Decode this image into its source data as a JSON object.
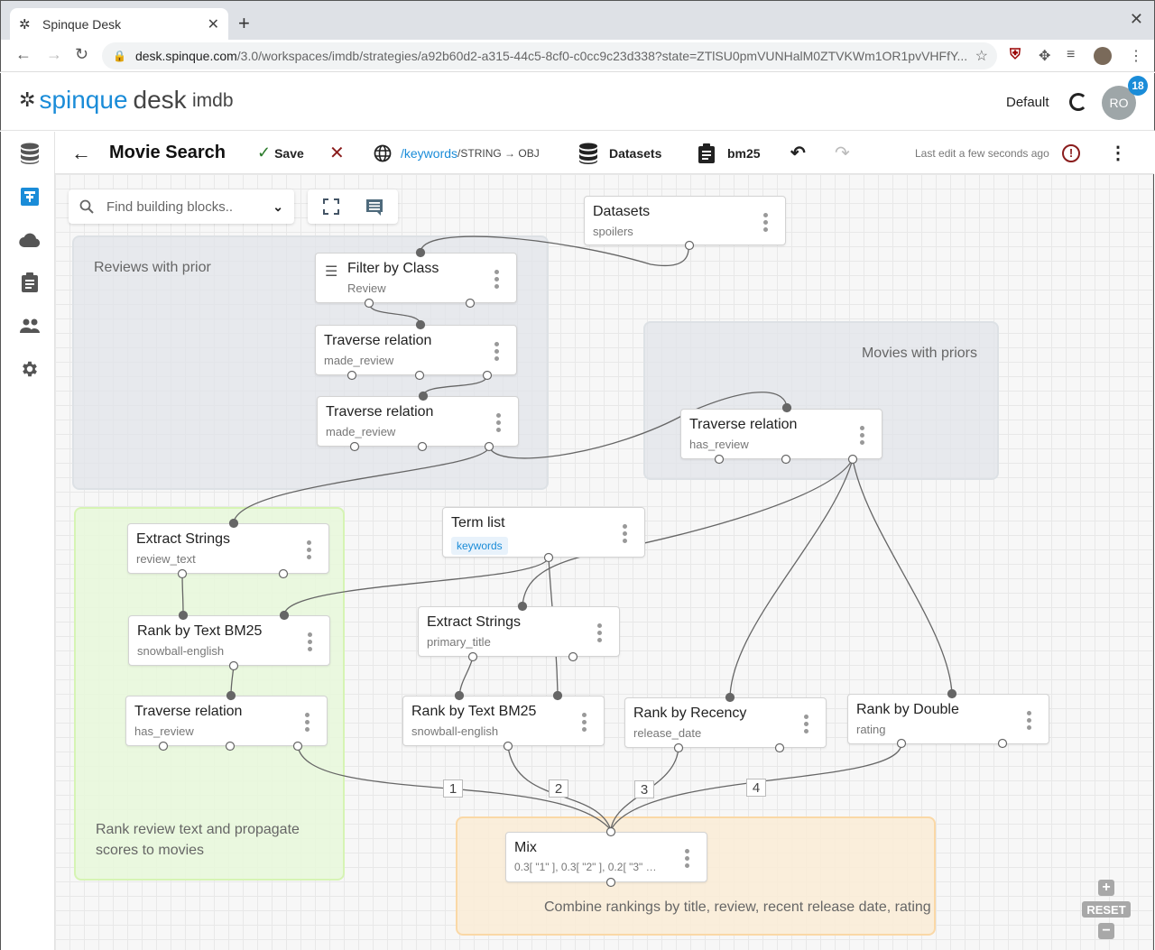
{
  "browser": {
    "tab_title": "Spinque Desk",
    "url_host": "desk.spinque.com",
    "url_path": "/3.0/workspaces/imdb/strategies/a92b60d2-a315-44c5-8cf0-c0cc9c23d338?state=ZTlSU0pmVUNHalM0ZTVKWm1OR1pvVHFfY..."
  },
  "header": {
    "logo_spinque": "spinque",
    "logo_desk": "desk",
    "workspace": "imdb",
    "environment": "Default",
    "avatar_initials": "RO",
    "notification_count": "18"
  },
  "rail": {
    "items": [
      {
        "name": "datasets",
        "icon": "database-icon",
        "active": false
      },
      {
        "name": "strategies",
        "icon": "hierarchy-icon",
        "active": true
      },
      {
        "name": "cloud",
        "icon": "cloud-icon",
        "active": false
      },
      {
        "name": "tasks",
        "icon": "clipboard-icon",
        "active": false
      },
      {
        "name": "users",
        "icon": "people-icon",
        "active": false
      },
      {
        "name": "settings",
        "icon": "gear-icon",
        "active": false
      }
    ]
  },
  "toolbar": {
    "title": "Movie Search",
    "save_label": "Save",
    "endpoint_prefix": "/",
    "endpoint_keyword": "keywords",
    "endpoint_type": "/STRING → OBJ",
    "datasets_label": "Datasets",
    "config_label": "bm25",
    "last_edit": "Last edit a few seconds ago"
  },
  "canvas": {
    "search_placeholder": "Find building blocks..",
    "groups": [
      {
        "label": "Reviews with prior",
        "color": "#eceef1"
      },
      {
        "label": "Movies with priors",
        "color": "#eceef1"
      },
      {
        "label": "Rank review text and propagate scores to movies",
        "color": "#eaf8dc"
      },
      {
        "label": "Combine rankings by title, review, recent release date, rating",
        "color": "#faeedb"
      }
    ],
    "nodes": [
      {
        "id": "datasets",
        "title": "Datasets",
        "sub": "spoilers"
      },
      {
        "id": "filter",
        "title": "Filter by Class",
        "sub": "Review"
      },
      {
        "id": "trav1",
        "title": "Traverse relation",
        "sub": "made_review"
      },
      {
        "id": "trav2",
        "title": "Traverse relation",
        "sub": "made_review"
      },
      {
        "id": "trav3",
        "title": "Traverse relation",
        "sub": "has_review"
      },
      {
        "id": "extract1",
        "title": "Extract Strings",
        "sub": "review_text"
      },
      {
        "id": "termlist",
        "title": "Term list",
        "sub": "keywords"
      },
      {
        "id": "rank1",
        "title": "Rank by Text BM25",
        "sub": "snowball-english"
      },
      {
        "id": "extract2",
        "title": "Extract Strings",
        "sub": "primary_title"
      },
      {
        "id": "trav4",
        "title": "Traverse relation",
        "sub": "has_review"
      },
      {
        "id": "rank2",
        "title": "Rank by Text BM25",
        "sub": "snowball-english"
      },
      {
        "id": "recency",
        "title": "Rank by Recency",
        "sub": "release_date"
      },
      {
        "id": "double",
        "title": "Rank by Double",
        "sub": "rating"
      },
      {
        "id": "mix",
        "title": "Mix",
        "sub": "0.3[ \"1\" ], 0.3[ \"2\" ], 0.2[ \"3\" …"
      }
    ],
    "mix_inputs": [
      "1",
      "2",
      "3",
      "4"
    ],
    "zoom": {
      "plus": "+",
      "reset": "RESET",
      "minus": "−"
    }
  }
}
